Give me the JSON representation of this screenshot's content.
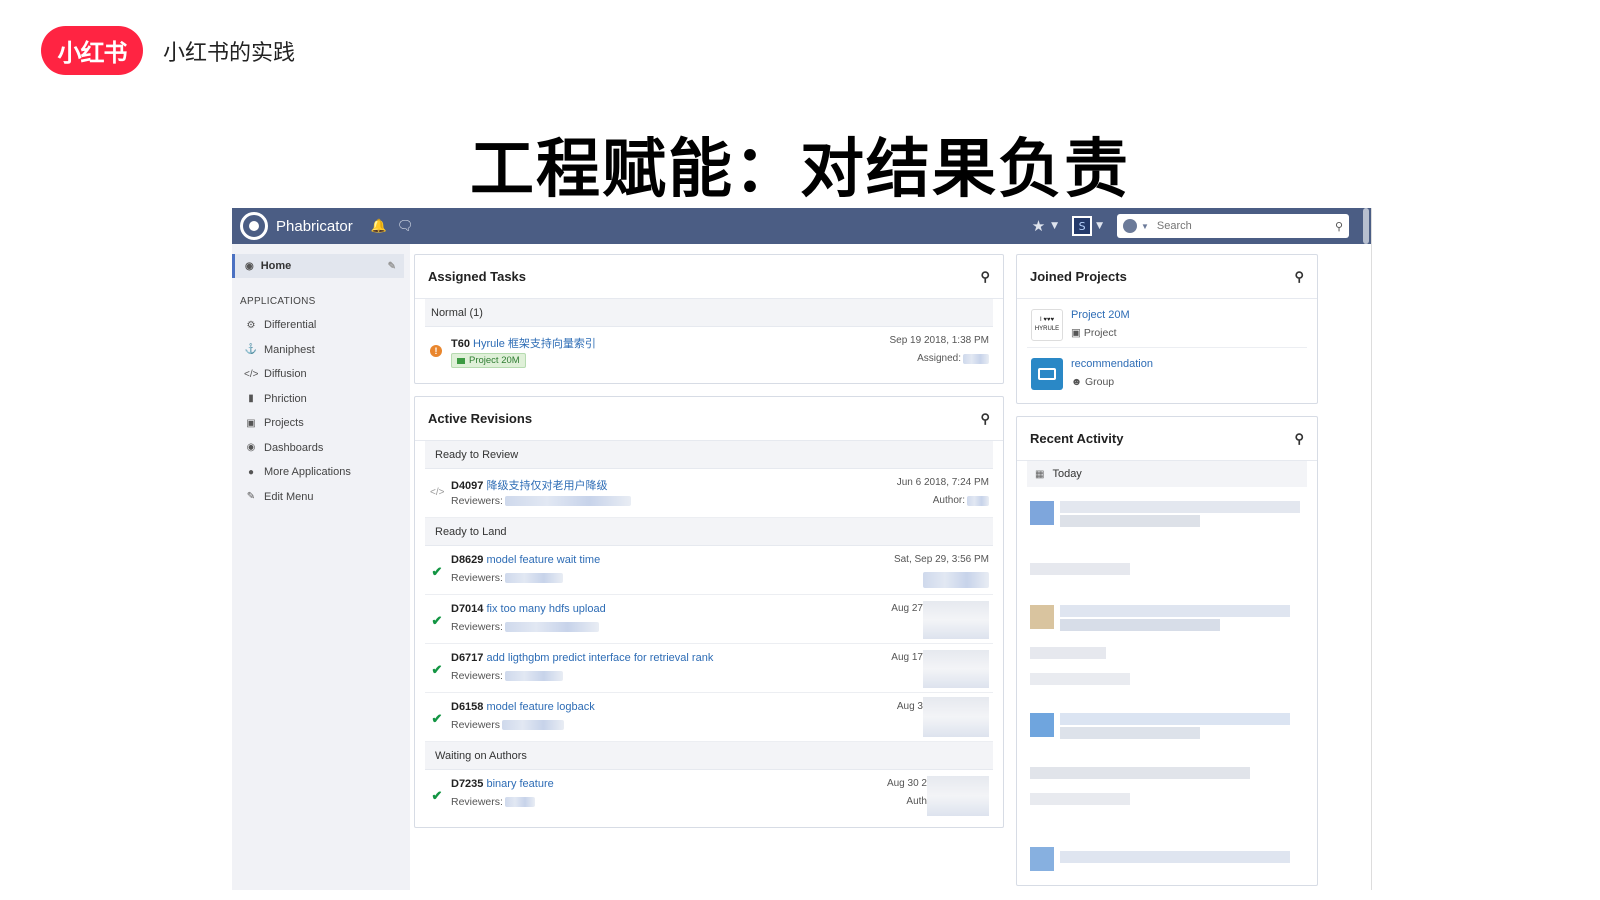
{
  "slide": {
    "brand_logo": "小红书",
    "brand_text": "小红书的实践",
    "title": "工程赋能：对结果负责"
  },
  "app": {
    "name": "Phabricator",
    "search_placeholder": "Search",
    "avatar_letter": "S"
  },
  "sidebar": {
    "home": "Home",
    "section": "APPLICATIONS",
    "items": [
      {
        "label": "Differential",
        "icon": "gear-icon"
      },
      {
        "label": "Maniphest",
        "icon": "anchor-icon"
      },
      {
        "label": "Diffusion",
        "icon": "code-icon"
      },
      {
        "label": "Phriction",
        "icon": "book-icon"
      },
      {
        "label": "Projects",
        "icon": "briefcase-icon"
      },
      {
        "label": "Dashboards",
        "icon": "dashboard-icon"
      },
      {
        "label": "More Applications",
        "icon": "globe-icon"
      },
      {
        "label": "Edit Menu",
        "icon": "pencil-icon"
      }
    ]
  },
  "assigned": {
    "title": "Assigned Tasks",
    "group": "Normal (1)",
    "task": {
      "id": "T60",
      "name": "Hyrule 框架支持向量索引",
      "tag": "Project 20M",
      "date": "Sep 19 2018, 1:38 PM",
      "assigned_label": "Assigned:"
    }
  },
  "revisions": {
    "title": "Active Revisions",
    "groups": [
      {
        "label": "Ready to Review",
        "rows": [
          {
            "id": "D4097",
            "name": "降级支持仅对老用户降级",
            "date": "Jun 6 2018, 7:24 PM",
            "reviewers_label": "Reviewers:",
            "right_label": "Author:"
          }
        ]
      },
      {
        "label": "Ready to Land",
        "rows": [
          {
            "id": "D8629",
            "name": "model feature wait time",
            "date": "Sat, Sep 29, 3:56 PM",
            "reviewers_label": "Reviewers:"
          },
          {
            "id": "D7014",
            "name": "fix too many hdfs upload",
            "date": "Aug 27",
            "reviewers_label": "Reviewers:"
          },
          {
            "id": "D6717",
            "name": "add ligthgbm predict interface for retrieval rank",
            "date": "Aug 17",
            "reviewers_label": "Reviewers:"
          },
          {
            "id": "D6158",
            "name": "model feature logback",
            "date": "Aug 3",
            "reviewers_label": "Reviewers"
          }
        ]
      },
      {
        "label": "Waiting on Authors",
        "rows": [
          {
            "id": "D7235",
            "name": "binary feature",
            "date": "Aug 30 2",
            "reviewers_label": "Reviewers:",
            "right_label": "Auth"
          }
        ]
      }
    ]
  },
  "joined": {
    "title": "Joined Projects",
    "projects": [
      {
        "name": "Project 20M",
        "kind": "Project",
        "image_text": "I ♥♥♥ HYRULE"
      },
      {
        "name": "recommendation",
        "kind": "Group"
      }
    ]
  },
  "activity": {
    "title": "Recent Activity",
    "today": "Today"
  },
  "colors": {
    "topbar": "#4b5d84",
    "link": "#2d6cb5",
    "brand": "#ff2442",
    "ok": "#139543",
    "warn": "#e9862d"
  }
}
